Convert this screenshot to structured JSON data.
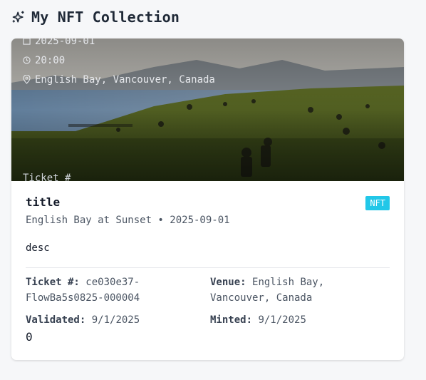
{
  "header": {
    "title": "My NFT Collection",
    "icon": "sparkle-icon"
  },
  "hero": {
    "date": "2025-09-01",
    "time": "20:00",
    "location": "English Bay, Vancouver, Canada",
    "ticket_label": "Ticket #"
  },
  "card": {
    "title": "title",
    "badge": "NFT",
    "subtitle": "English Bay at Sunset • 2025-09-01",
    "description": "desc",
    "ticket_label": "Ticket #:",
    "ticket_value": "ce030e37-FlowBa5s0825-000004",
    "venue_label": "Venue:",
    "venue_value": "English Bay, Vancouver, Canada",
    "validated_label": "Validated:",
    "validated_value": "9/1/2025",
    "minted_label": "Minted:",
    "minted_value": "9/1/2025",
    "count": "0"
  },
  "colors": {
    "badge": "#22c7e8",
    "background": "#f6f7f9",
    "card": "#ffffff"
  }
}
